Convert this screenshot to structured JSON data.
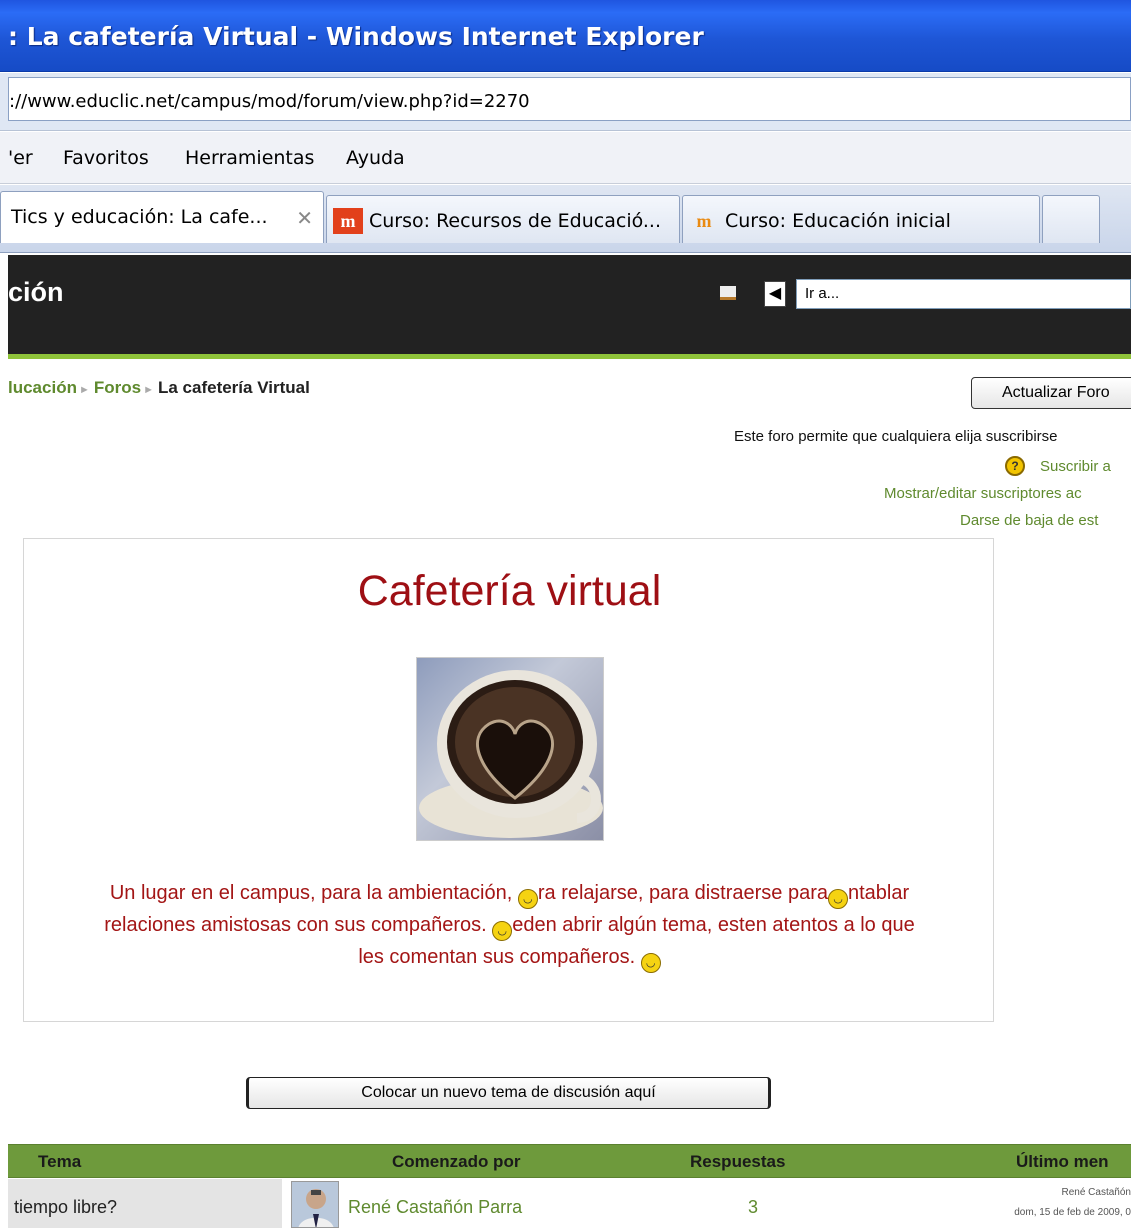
{
  "window": {
    "title": ": La cafetería Virtual - Windows Internet Explorer",
    "url": "://www.educlic.net/campus/mod/forum/view.php?id=2270"
  },
  "menu": [
    "'er",
    "Favoritos",
    "Herramientas",
    "Ayuda"
  ],
  "tabs": [
    {
      "label": "Tics y educación: La cafe...",
      "active": true
    },
    {
      "label": "Curso: Recursos de Educació...",
      "icon": "moodle-red-icon"
    },
    {
      "label": "Curso: Educación inicial",
      "icon": "moodle-orange-icon"
    }
  ],
  "header": {
    "site_name": "ción",
    "jump_placeholder": "Ir a..."
  },
  "breadcrumb": {
    "item1": "lucación",
    "item2": "Foros",
    "current": "La cafetería Virtual",
    "sep": "►"
  },
  "controls": {
    "update_button": "Actualizar Foro",
    "subscribe_notice": "Este foro permite que cualquiera elija suscribirse",
    "subscribe_link": "Suscribir a",
    "show_subscribers_link": "Mostrar/editar suscriptores ac",
    "unsubscribe_link": "Darse de baja de est"
  },
  "intro": {
    "title": "Cafetería virtual",
    "line1": "Un lugar en el campus, para la ambientación, ",
    "line1b": "ra relajarse, para distraerse para",
    "line1c": "ntablar",
    "line2": "relaciones amistosas con sus compañeros. ",
    "line2b": "eden abrir algún tema, esten atentos a lo que",
    "line3": "les comentan sus compañeros."
  },
  "new_topic_button": "Colocar un nuevo tema de discusión aquí",
  "table": {
    "headers": [
      "Tema",
      "Comenzado por",
      "Respuestas",
      "Último men"
    ],
    "rows": [
      {
        "topic": "tiempo libre?",
        "author": "René Castañón Parra",
        "replies": "3",
        "last_author": "René Castañón",
        "last_date": "dom, 15 de feb de 2009, 0"
      }
    ]
  },
  "colors": {
    "titlebar": "#1e56d6",
    "moodle_header": "#222222",
    "accent_green": "#8fc33a",
    "link_green": "#5f8a2e",
    "intro_red": "#9e0f14",
    "table_header": "#6e9a3c"
  }
}
